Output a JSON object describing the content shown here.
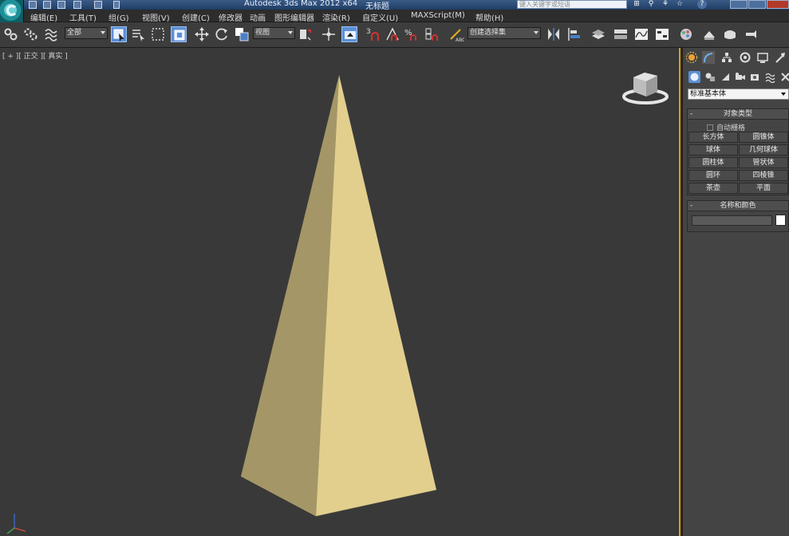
{
  "window": {
    "title": "Autodesk 3ds Max  2012 x64",
    "filename": "无标题",
    "help_search_placeholder": "键入关键字或短语"
  },
  "menu": [
    {
      "id": "edit",
      "label": "编辑(E)"
    },
    {
      "id": "tools",
      "label": "工具(T)"
    },
    {
      "id": "group",
      "label": "组(G)"
    },
    {
      "id": "views",
      "label": "视图(V)"
    },
    {
      "id": "create",
      "label": "创建(C)"
    },
    {
      "id": "modifiers",
      "label": "修改器"
    },
    {
      "id": "animation",
      "label": "动画"
    },
    {
      "id": "graph-editors",
      "label": "图形编辑器"
    },
    {
      "id": "rendering",
      "label": "渲染(R)"
    },
    {
      "id": "customize",
      "label": "自定义(U)"
    },
    {
      "id": "maxscript",
      "label": "MAXScript(M)"
    },
    {
      "id": "help",
      "label": "帮助(H)"
    }
  ],
  "toolbar": {
    "selection_filter": "全部",
    "ref_coord_system": "视图",
    "named_selection_set": "创建选择集"
  },
  "viewport": {
    "label": "[ + ][ 正交 ][ 真实 ]",
    "object_color": "#e2cf8e",
    "active_border_color": "#d9a300"
  },
  "command_panel": {
    "category": "标准基本体",
    "object_type_title": "对象类型",
    "autogrid_label": "自动栅格",
    "object_buttons": [
      "长方体",
      "圆锥体",
      "球体",
      "几何球体",
      "圆柱体",
      "管状体",
      "圆环",
      "四棱锥",
      "茶壶",
      "平面"
    ],
    "name_color_title": "名称和颜色",
    "name_value": "",
    "swatch_color": "#ffffff"
  }
}
